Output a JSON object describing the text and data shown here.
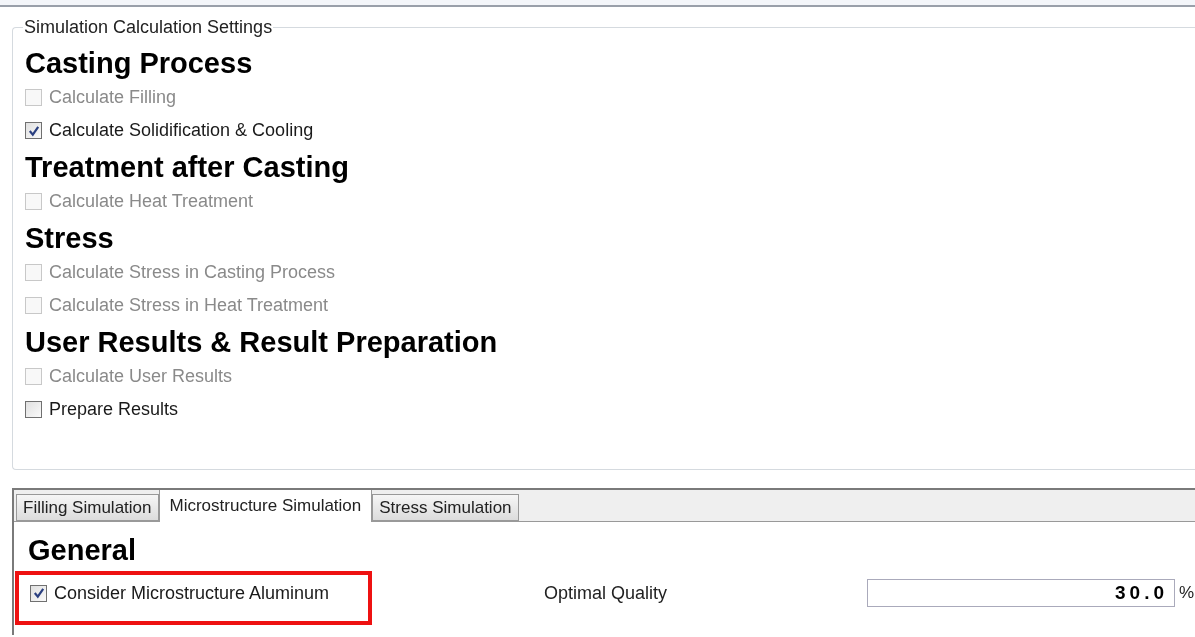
{
  "group_title": "Simulation Calculation Settings",
  "sections": [
    {
      "heading": "Casting Process",
      "options": [
        {
          "label": "Calculate Filling",
          "checked": false,
          "disabled": true
        },
        {
          "label": "Calculate Solidification & Cooling",
          "checked": true,
          "disabled": false
        }
      ]
    },
    {
      "heading": "Treatment after Casting",
      "options": [
        {
          "label": "Calculate Heat Treatment",
          "checked": false,
          "disabled": true
        }
      ]
    },
    {
      "heading": "Stress",
      "options": [
        {
          "label": "Calculate Stress in Casting Process",
          "checked": false,
          "disabled": true
        },
        {
          "label": "Calculate Stress in Heat Treatment",
          "checked": false,
          "disabled": true
        }
      ]
    },
    {
      "heading": "User Results & Result Preparation",
      "options": [
        {
          "label": "Calculate User Results",
          "checked": false,
          "disabled": true
        },
        {
          "label": "Prepare Results",
          "checked": false,
          "disabled": false
        }
      ]
    }
  ],
  "tabs": [
    {
      "label": "Filling Simulation",
      "selected": false
    },
    {
      "label": "Microstructure Simulation",
      "selected": true
    },
    {
      "label": "Stress Simulation",
      "selected": false
    }
  ],
  "panel": {
    "heading": "General",
    "option": {
      "label": "Consider Microstructure Aluminum",
      "checked": true,
      "disabled": false,
      "highlighted": true
    },
    "field_label": "Optimal Quality",
    "field_value": "30.0",
    "unit": "%"
  }
}
